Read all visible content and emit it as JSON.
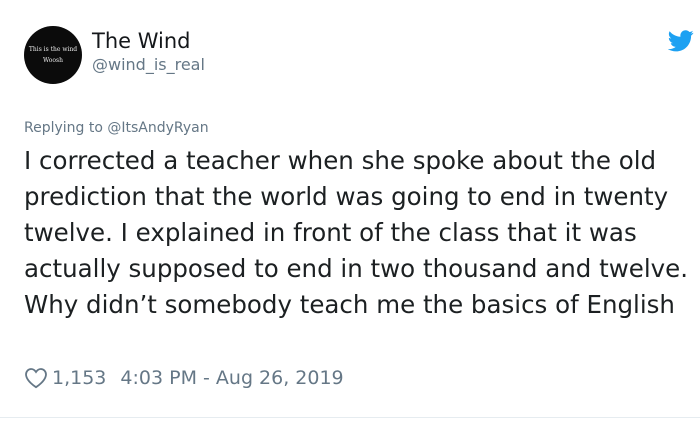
{
  "author": {
    "display_name": "The Wind",
    "handle": "@wind_is_real",
    "avatar_text_line1": "This is the wind",
    "avatar_text_line2": "Woosh"
  },
  "reply": {
    "text": "Replying to @ItsAndyRyan"
  },
  "tweet": {
    "text": "I corrected a teacher when she spoke about the old prediction that the world was going to end in twenty twelve. I explained in front of the class that it was actually supposed to end in two thousand and twelve. Why didn’t somebody teach me the basics of English"
  },
  "footer": {
    "likes": "1,153",
    "timestamp": "4:03 PM - Aug 26, 2019"
  },
  "icons": {
    "brand": "twitter-bird-icon",
    "like": "heart-outline-icon"
  },
  "colors": {
    "brand": "#1da1f2",
    "muted": "#657786",
    "text": "#1c2022",
    "divider": "#e6ecf0"
  }
}
